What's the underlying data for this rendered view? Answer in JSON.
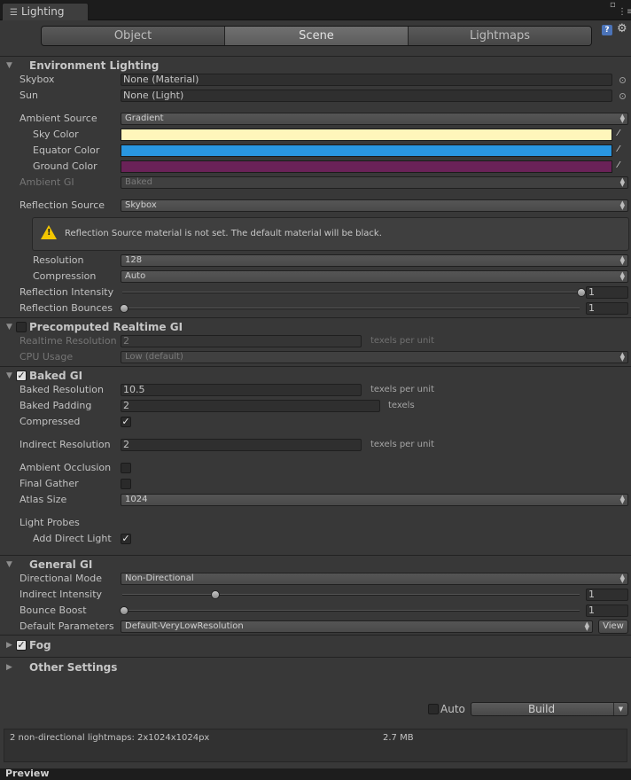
{
  "window": {
    "tab_title": "Lighting",
    "tab_icon": "lighting-icon"
  },
  "tabs": [
    {
      "label": "Object",
      "selected": false
    },
    {
      "label": "Scene",
      "selected": true
    },
    {
      "label": "Lightmaps",
      "selected": false
    }
  ],
  "env": {
    "header": "Environment Lighting",
    "skybox_label": "Skybox",
    "skybox_value": "None (Material)",
    "sun_label": "Sun",
    "sun_value": "None (Light)",
    "ambient_source_label": "Ambient Source",
    "ambient_source_value": "Gradient",
    "sky_color_label": "Sky Color",
    "sky_color": "#fff6bb",
    "equator_color_label": "Equator Color",
    "equator_color": "#2996e0",
    "ground_color_label": "Ground Color",
    "ground_color": "#6a2258",
    "ambient_gi_label": "Ambient GI",
    "ambient_gi_value": "Baked",
    "reflection_source_label": "Reflection Source",
    "reflection_source_value": "Skybox",
    "warning_text": "Reflection Source material is not set. The default material will be black.",
    "resolution_label": "Resolution",
    "resolution_value": "128",
    "compression_label": "Compression",
    "compression_value": "Auto",
    "reflection_intensity_label": "Reflection Intensity",
    "reflection_intensity_value": "1",
    "reflection_intensity_fraction": 1.0,
    "reflection_bounces_label": "Reflection Bounces",
    "reflection_bounces_value": "1",
    "reflection_bounces_fraction": 0.0
  },
  "realtime": {
    "header": "Precomputed Realtime GI",
    "enabled": false,
    "resolution_label": "Realtime Resolution",
    "resolution_value": "2",
    "resolution_unit": "texels per unit",
    "cpu_label": "CPU Usage",
    "cpu_value": "Low (default)"
  },
  "baked": {
    "header": "Baked GI",
    "enabled": true,
    "resolution_label": "Baked Resolution",
    "resolution_value": "10.5",
    "resolution_unit": "texels per unit",
    "padding_label": "Baked Padding",
    "padding_value": "2",
    "padding_unit": "texels",
    "compressed_label": "Compressed",
    "compressed": true,
    "indirect_label": "Indirect Resolution",
    "indirect_value": "2",
    "indirect_unit": "texels per unit",
    "ao_label": "Ambient Occlusion",
    "ao": false,
    "final_gather_label": "Final Gather",
    "final_gather": false,
    "atlas_label": "Atlas Size",
    "atlas_value": "1024",
    "light_probes_label": "Light Probes",
    "add_direct_label": "Add Direct Light",
    "add_direct": true
  },
  "general": {
    "header": "General GI",
    "dir_mode_label": "Directional Mode",
    "dir_mode_value": "Non-Directional",
    "indirect_intensity_label": "Indirect Intensity",
    "indirect_intensity_value": "1",
    "indirect_intensity_fraction": 0.2,
    "bounce_boost_label": "Bounce Boost",
    "bounce_boost_value": "1",
    "bounce_boost_fraction": 0.0,
    "default_params_label": "Default Parameters",
    "default_params_value": "Default-VeryLowResolution",
    "view_label": "View"
  },
  "fog": {
    "header": "Fog",
    "enabled": true
  },
  "other": {
    "header": "Other Settings"
  },
  "build": {
    "auto_label": "Auto",
    "auto": false,
    "build_label": "Build"
  },
  "status": {
    "lightmaps_text": "2 non-directional lightmaps: 2x1024x1024px",
    "size_text": "2.7 MB"
  },
  "preview": {
    "label": "Preview"
  }
}
